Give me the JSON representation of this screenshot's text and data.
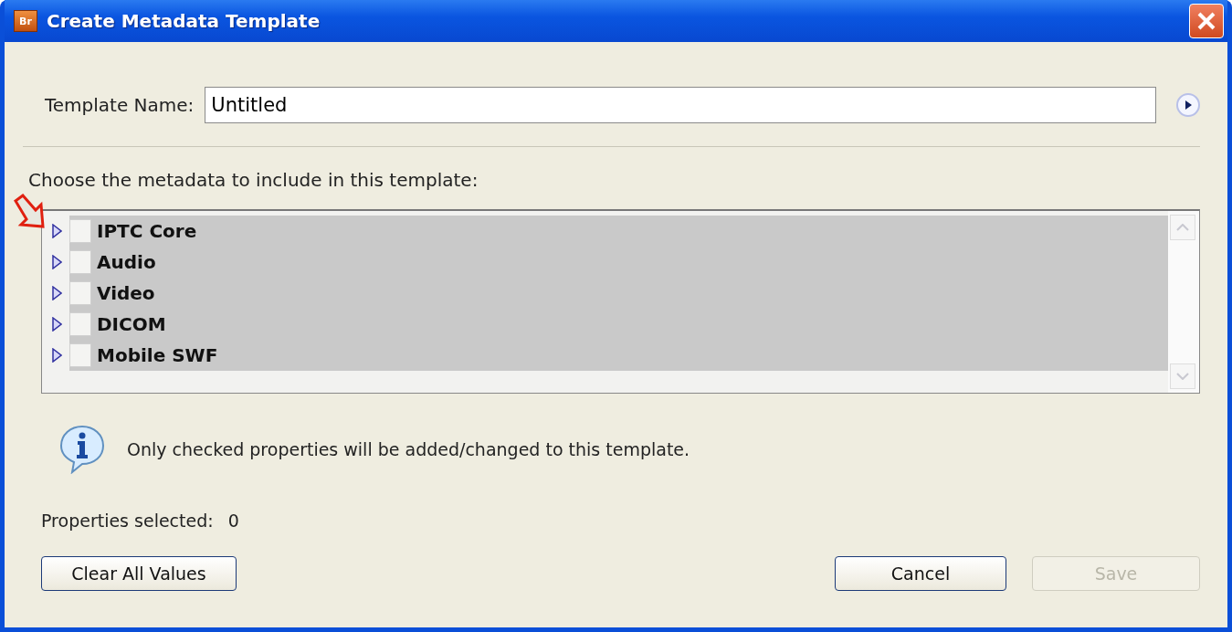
{
  "window": {
    "title": "Create Metadata Template",
    "app_badge": "Br"
  },
  "template_name": {
    "label": "Template Name:",
    "value": "Untitled"
  },
  "instruction": "Choose the metadata to include in this template:",
  "tree": [
    {
      "label": "IPTC Core",
      "expanded": false,
      "checked": false
    },
    {
      "label": "Audio",
      "expanded": false,
      "checked": false
    },
    {
      "label": "Video",
      "expanded": false,
      "checked": false
    },
    {
      "label": "DICOM",
      "expanded": false,
      "checked": false
    },
    {
      "label": "Mobile SWF",
      "expanded": false,
      "checked": false
    }
  ],
  "info": "Only checked properties will be added/changed to this template.",
  "properties_selected": {
    "label": "Properties selected:",
    "count": "0"
  },
  "buttons": [
    {
      "label": "Clear All Values",
      "disabled": false
    },
    {
      "label": "Cancel",
      "disabled": false
    },
    {
      "label": "Save",
      "disabled": true
    }
  ]
}
